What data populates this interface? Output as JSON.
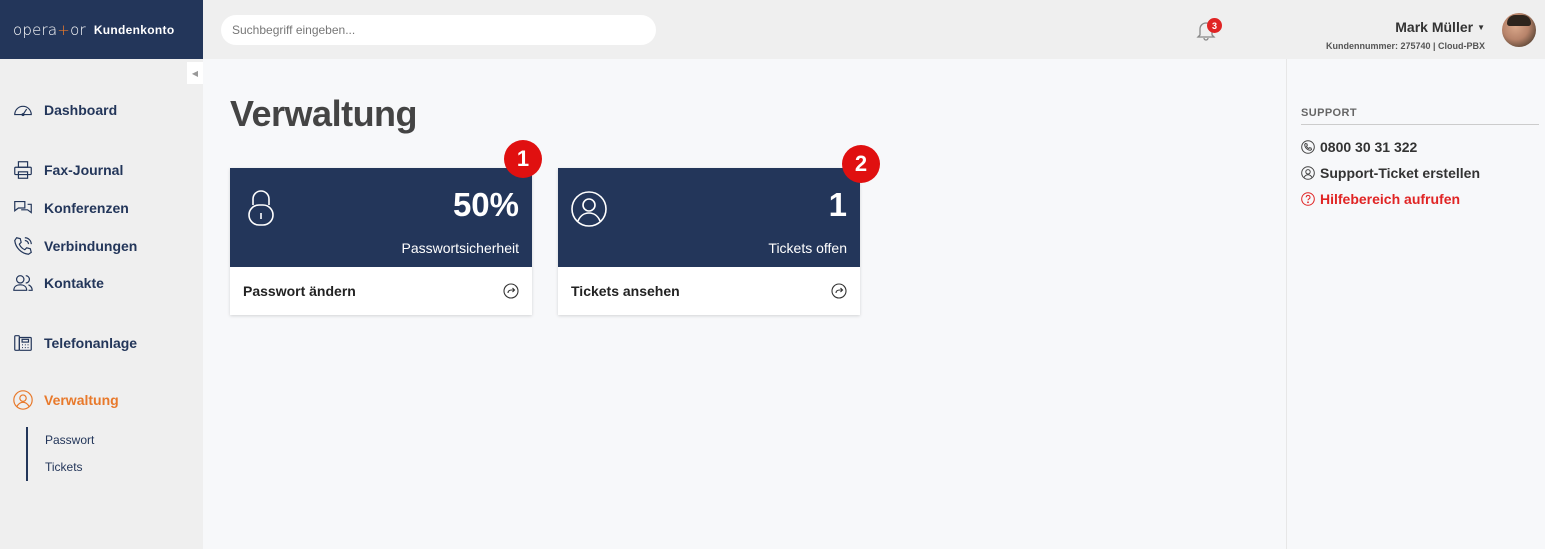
{
  "brand": {
    "logo": "opera+or",
    "logo_a": "opera",
    "logo_plus": "+",
    "logo_b": "or",
    "section": "Kundenkonto"
  },
  "search": {
    "placeholder": "Suchbegriff eingeben..."
  },
  "notifications": {
    "count": "3"
  },
  "user": {
    "name": "Mark Müller",
    "meta": "Kundennummer: 275740 | Cloud-PBX"
  },
  "sidebar": {
    "items": [
      {
        "label": "Dashboard",
        "icon": "speedometer-icon"
      },
      {
        "label": "Fax-Journal",
        "icon": "printer-icon"
      },
      {
        "label": "Konferenzen",
        "icon": "chat-bubbles-icon"
      },
      {
        "label": "Verbindungen",
        "icon": "phone-icon"
      },
      {
        "label": "Kontakte",
        "icon": "users-icon"
      },
      {
        "label": "Telefonanlage",
        "icon": "desk-phone-icon"
      },
      {
        "label": "Verwaltung",
        "icon": "user-circle-icon",
        "active": true
      }
    ],
    "subitems": [
      {
        "label": "Passwort"
      },
      {
        "label": "Tickets"
      }
    ],
    "accent_color": "#e8792b"
  },
  "main": {
    "title": "Verwaltung",
    "cards": [
      {
        "value": "50%",
        "caption": "Passwortsicherheit",
        "link_label": "Passwort ändern",
        "icon": "padlock-icon",
        "badge": "1"
      },
      {
        "value": "1",
        "caption": "Tickets offen",
        "link_label": "Tickets ansehen",
        "icon": "user-circle-icon",
        "badge": "2"
      }
    ]
  },
  "support": {
    "heading": "SUPPORT",
    "phone": "0800 30 31 322",
    "ticket": "Support-Ticket erstellen",
    "help": "Hilfebereich aufrufen"
  },
  "colors": {
    "navy": "#23365a",
    "orange": "#e8792b",
    "red": "#e02424"
  }
}
